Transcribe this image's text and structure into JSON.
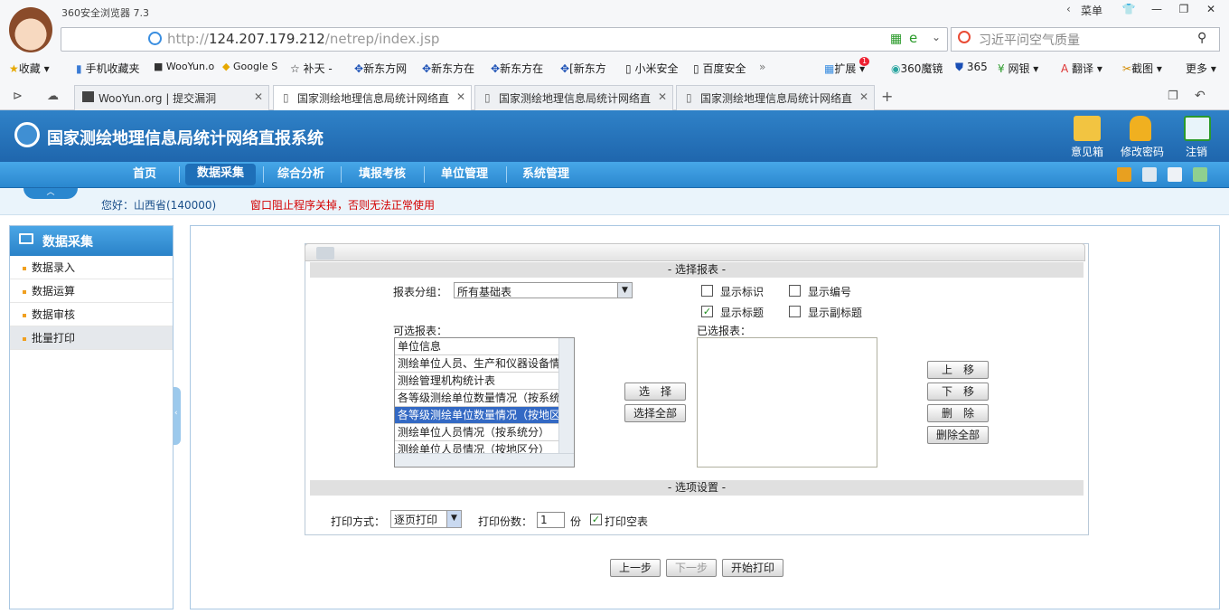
{
  "browser": {
    "title": "360安全浏览器 7.3",
    "menu_label": "菜单",
    "url_prefix": "http://",
    "url_host": "124.207.179.212",
    "url_path": "/netrep/index.jsp",
    "search_text": "习近平问空气质量",
    "bookmarks": [
      "收藏",
      "手机收藏夹",
      "WooYun.o",
      "Google S",
      "补天 -",
      "新东方网",
      "新东方在",
      "新东方在",
      "[新东方",
      "小米安全",
      "百度安全",
      "扩展",
      "360魔镜",
      "365",
      "网银",
      "翻译",
      "截图",
      "更多"
    ],
    "tabs": [
      "WooYun.org | 提交漏洞",
      "国家测绘地理信息局统计网络直",
      "国家测绘地理信息局统计网络直",
      "国家测绘地理信息局统计网络直"
    ]
  },
  "app": {
    "title": "国家测绘地理信息局统计网络直报系统",
    "header_actions": [
      "意见箱",
      "修改密码",
      "注销"
    ],
    "nav": [
      "首页",
      "数据采集",
      "综合分析",
      "填报考核",
      "单位管理",
      "系统管理"
    ],
    "greeting": "您好：山西省(140000)",
    "warning": "窗口阻止程序关掉，否则无法正常使用"
  },
  "sidebar": {
    "title": "数据采集",
    "items": [
      "数据录入",
      "数据运算",
      "数据审核",
      "批量打印"
    ]
  },
  "form": {
    "section_select": "- 选择报表 -",
    "group_label": "报表分组：",
    "group_value": "所有基础表",
    "opt_show_id": "显示标识",
    "opt_show_no": "显示编号",
    "opt_show_title": "显示标题",
    "opt_show_subtitle": "显示副标题",
    "available_label": "可选报表：",
    "available": [
      "单位信息",
      "测绘单位人员、生产和仪器设备情",
      "测绘管理机构统计表",
      "各等级测绘单位数量情况（按系统",
      "各等级测绘单位数量情况（按地区",
      "测绘单位人员情况（按系统分）",
      "测绘单位人员情况（按地区分）"
    ],
    "selected_label": "已选报表：",
    "btn_select": "选　择",
    "btn_select_all": "选择全部",
    "btn_up": "上　移",
    "btn_down": "下　移",
    "btn_delete": "删　除",
    "btn_delete_all": "删除全部",
    "section_options": "- 选项设置 -",
    "print_mode_label": "打印方式：",
    "print_mode_value": "逐页打印",
    "copies_label": "打印份数：",
    "copies_value": "1",
    "copies_unit": "份",
    "print_empty_label": "打印空表",
    "btn_prev": "上一步",
    "btn_next": "下一步",
    "btn_print": "开始打印"
  }
}
